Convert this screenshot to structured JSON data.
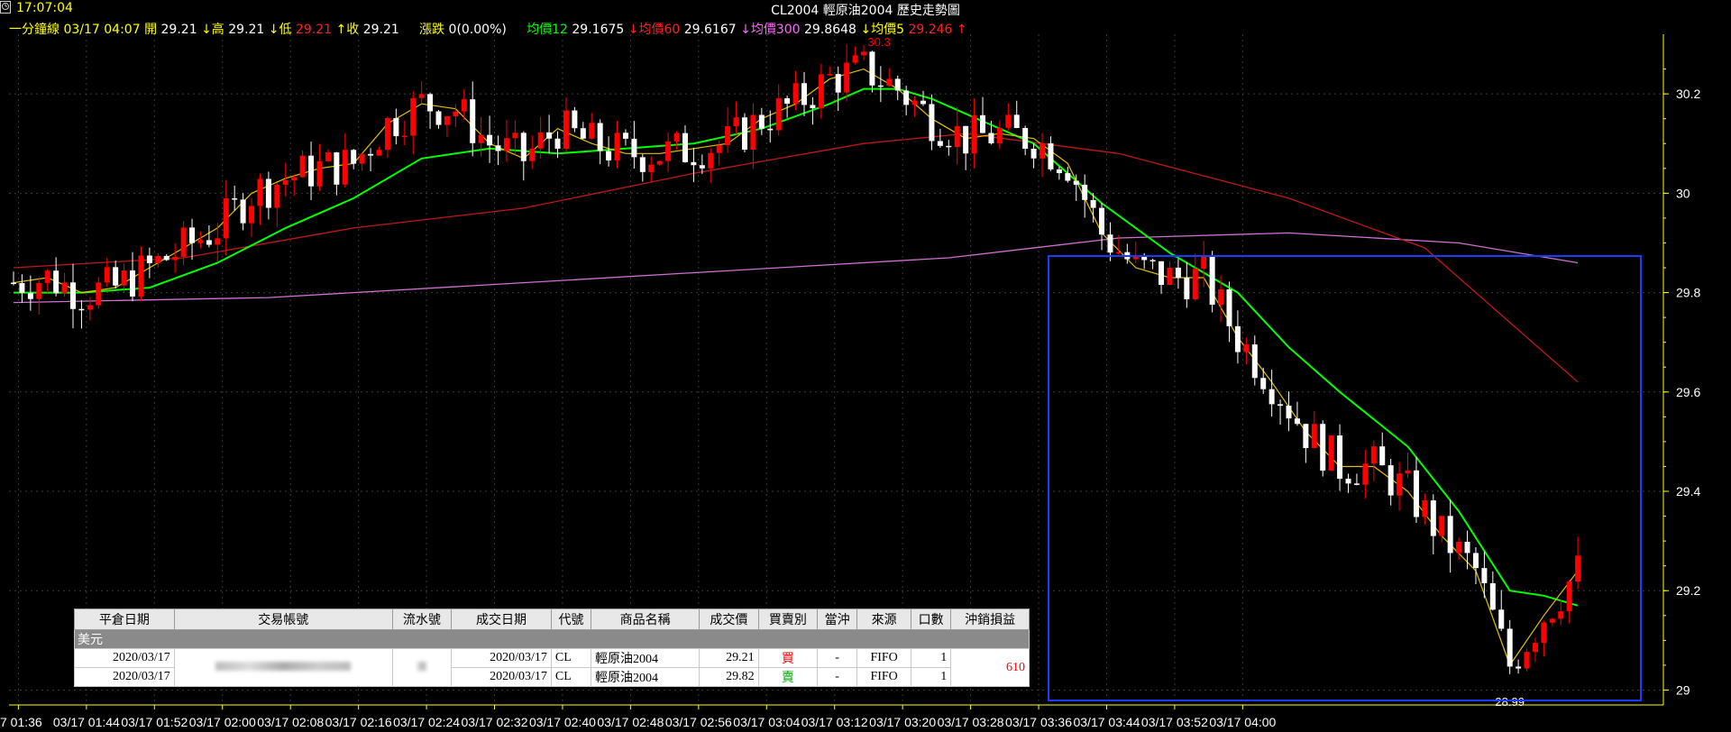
{
  "header": {
    "clock": "17:07:04",
    "title": "CL2004  輕原油2004   歷史走勢圖"
  },
  "info": {
    "period": "一分鐘線",
    "datetime": "03/17 04:07",
    "open_label": "開",
    "open": "29.21",
    "high_label": "↓高",
    "high": "29.21",
    "low_label": "↓低",
    "low": "29.21",
    "close_label": "↑收",
    "close": "29.21",
    "change_label": "漲跌",
    "change": "0(0.00%)",
    "ma12_label": "均價12",
    "ma12": "29.1675",
    "ma60_label": "↓均價60",
    "ma60": "29.6167",
    "ma300_label": "↓均價300",
    "ma300": "29.8648",
    "ma5_label": "↓均價5",
    "ma5": "29.246",
    "ma5_arrow": "↑"
  },
  "chart_data": {
    "type": "candlestick",
    "ylim": [
      28.97,
      30.32
    ],
    "y_ticks": [
      29,
      29.2,
      29.4,
      29.6,
      29.8,
      30,
      30.2
    ],
    "x_tick_labels": [
      "7 01:36",
      "03/17 01:44",
      "03/17 01:52",
      "03/17 02:00",
      "03/17 02:08",
      "03/17 02:16",
      "03/17 02:24",
      "03/17 02:32",
      "03/17 02:40",
      "03/17 02:48",
      "03/17 02:56",
      "03/17 03:04",
      "03/17 03:12",
      "03/17 03:20",
      "03/17 03:28",
      "03/17 03:36",
      "03/17 03:44",
      "03/17 03:52",
      "03/17 04:00"
    ],
    "annotations": {
      "max_label": "30.3",
      "min_label": "28.99"
    },
    "colors": {
      "up": "#ff0000",
      "down": "#ffffff",
      "ma5": "#e0c000",
      "ma12": "#00ff00",
      "ma60": "#c01818",
      "ma300": "#d070d0",
      "grid": "#3a3a3a",
      "axis": "#ffff00",
      "selection": "#1a3cff"
    },
    "ma_series": {
      "ma5": [
        [
          0,
          29.82
        ],
        [
          4,
          29.83
        ],
        [
          8,
          29.8
        ],
        [
          12,
          29.81
        ],
        [
          16,
          29.85
        ],
        [
          20,
          29.89
        ],
        [
          24,
          29.93
        ],
        [
          28,
          30.0
        ],
        [
          32,
          30.03
        ],
        [
          36,
          30.05
        ],
        [
          40,
          30.06
        ],
        [
          44,
          30.14
        ],
        [
          48,
          30.18
        ],
        [
          52,
          30.17
        ],
        [
          56,
          30.1
        ],
        [
          60,
          30.07
        ],
        [
          64,
          30.13
        ],
        [
          68,
          30.1
        ],
        [
          72,
          30.08
        ],
        [
          76,
          30.08
        ],
        [
          80,
          30.09
        ],
        [
          84,
          30.1
        ],
        [
          88,
          30.15
        ],
        [
          92,
          30.18
        ],
        [
          96,
          30.23
        ],
        [
          100,
          30.25
        ],
        [
          104,
          30.21
        ],
        [
          108,
          30.15
        ],
        [
          112,
          30.11
        ],
        [
          116,
          30.12
        ],
        [
          120,
          30.11
        ],
        [
          124,
          30.06
        ],
        [
          128,
          29.92
        ],
        [
          132,
          29.85
        ],
        [
          136,
          29.83
        ],
        [
          140,
          29.83
        ],
        [
          144,
          29.71
        ],
        [
          148,
          29.62
        ],
        [
          152,
          29.52
        ],
        [
          156,
          29.45
        ],
        [
          160,
          29.45
        ],
        [
          164,
          29.4
        ],
        [
          168,
          29.31
        ],
        [
          172,
          29.24
        ],
        [
          176,
          29.05
        ],
        [
          180,
          29.15
        ],
        [
          184,
          29.24
        ]
      ],
      "ma12": [
        [
          0,
          29.8
        ],
        [
          8,
          29.8
        ],
        [
          16,
          29.81
        ],
        [
          24,
          29.86
        ],
        [
          32,
          29.93
        ],
        [
          40,
          29.99
        ],
        [
          48,
          30.07
        ],
        [
          56,
          30.09
        ],
        [
          64,
          30.08
        ],
        [
          72,
          30.09
        ],
        [
          80,
          30.1
        ],
        [
          88,
          30.13
        ],
        [
          96,
          30.18
        ],
        [
          100,
          30.21
        ],
        [
          104,
          30.21
        ],
        [
          108,
          30.19
        ],
        [
          112,
          30.16
        ],
        [
          120,
          30.1
        ],
        [
          128,
          29.98
        ],
        [
          136,
          29.88
        ],
        [
          144,
          29.8
        ],
        [
          150,
          29.69
        ],
        [
          156,
          29.6
        ],
        [
          164,
          29.49
        ],
        [
          170,
          29.36
        ],
        [
          176,
          29.2
        ],
        [
          180,
          29.19
        ],
        [
          184,
          29.17
        ]
      ],
      "ma60": [
        [
          0,
          29.85
        ],
        [
          20,
          29.87
        ],
        [
          40,
          29.93
        ],
        [
          60,
          29.97
        ],
        [
          80,
          30.04
        ],
        [
          100,
          30.1
        ],
        [
          112,
          30.12
        ],
        [
          130,
          30.08
        ],
        [
          150,
          29.99
        ],
        [
          166,
          29.89
        ],
        [
          184,
          29.62
        ]
      ],
      "ma300": [
        [
          0,
          29.78
        ],
        [
          30,
          29.79
        ],
        [
          60,
          29.82
        ],
        [
          90,
          29.85
        ],
        [
          110,
          29.87
        ],
        [
          130,
          29.91
        ],
        [
          150,
          29.92
        ],
        [
          170,
          29.9
        ],
        [
          184,
          29.86
        ]
      ]
    }
  },
  "table": {
    "headers": [
      "平倉日期",
      "交易帳號",
      "流水號",
      "成交日期",
      "代號",
      "商品名稱",
      "成交價",
      "買賣別",
      "當沖",
      "來源",
      "口數",
      "沖銷損益"
    ],
    "group_label": "美元",
    "rows": [
      {
        "close_date": "2020/03/17",
        "trade_date": "2020/03/17",
        "code": "CL",
        "name": "輕原油2004",
        "price": "29.21",
        "side": "買",
        "daytrade": "-",
        "source": "FIFO",
        "qty": "1"
      },
      {
        "close_date": "2020/03/17",
        "trade_date": "2020/03/17",
        "code": "CL",
        "name": "輕原油2004",
        "price": "29.82",
        "side": "賣",
        "daytrade": "-",
        "source": "FIFO",
        "qty": "1"
      }
    ],
    "pnl": "610"
  }
}
